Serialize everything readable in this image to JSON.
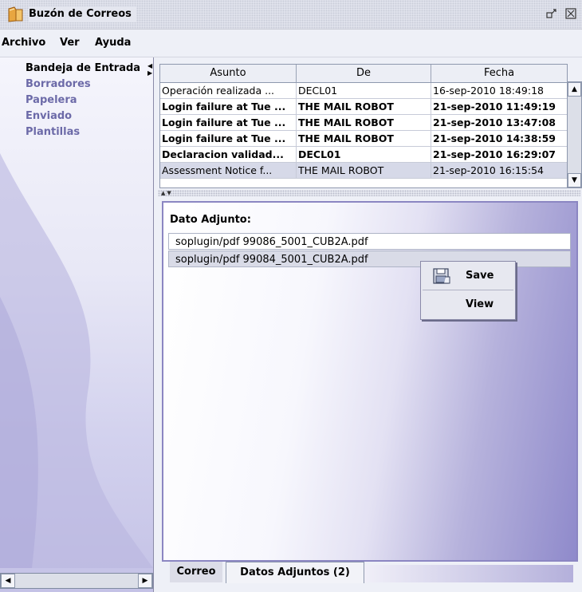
{
  "window": {
    "title": "Buzón de Correos"
  },
  "menu": [
    "Archivo",
    "Ver",
    "Ayuda"
  ],
  "folders": [
    {
      "label": "Bandeja de Entrada",
      "selected": true
    },
    {
      "label": "Borradores",
      "selected": false
    },
    {
      "label": "Papelera",
      "selected": false
    },
    {
      "label": "Enviado",
      "selected": false
    },
    {
      "label": "Plantillas",
      "selected": false
    }
  ],
  "table": {
    "columns": [
      "Asunto",
      "De",
      "Fecha"
    ],
    "rows": [
      {
        "asunto": "Operación realizada ...",
        "de": "DECL01",
        "fecha": "16-sep-2010 18:49:18",
        "bold": false
      },
      {
        "asunto": "Login failure at Tue ...",
        "de": "THE MAIL ROBOT",
        "fecha": "21-sep-2010 11:49:19",
        "bold": true
      },
      {
        "asunto": "Login failure at Tue ...",
        "de": "THE MAIL ROBOT",
        "fecha": "21-sep-2010 13:47:08",
        "bold": true
      },
      {
        "asunto": "Login failure at Tue ...",
        "de": "THE MAIL ROBOT",
        "fecha": "21-sep-2010 14:38:59",
        "bold": true
      },
      {
        "asunto": "Declaracion validad...",
        "de": "DECL01",
        "fecha": "21-sep-2010 16:29:07",
        "bold": true
      },
      {
        "asunto": "Assessment Notice f...",
        "de": "THE MAIL ROBOT",
        "fecha": "21-sep-2010 16:15:54",
        "bold": false,
        "selected": true
      }
    ]
  },
  "attachments": {
    "label": "Dato Adjunto:",
    "items": [
      "soplugin/pdf 99086_5001_CUB2A.pdf",
      "soplugin/pdf 99084_5001_CUB2A.pdf"
    ]
  },
  "context_menu": {
    "save": "Save",
    "view": "View"
  },
  "tabs": {
    "correo": "Correo",
    "datos_adjuntos": "Datos Adjuntos (2)"
  },
  "colors": {
    "accent_purple": "#8f8acb",
    "folder_link": "#6c6aa8",
    "selection": "#d6d9e8"
  },
  "icons": [
    "folder-book-icon",
    "restore-icon",
    "close-icon",
    "save-disk-icon",
    "scroll-arrow-icon"
  ]
}
